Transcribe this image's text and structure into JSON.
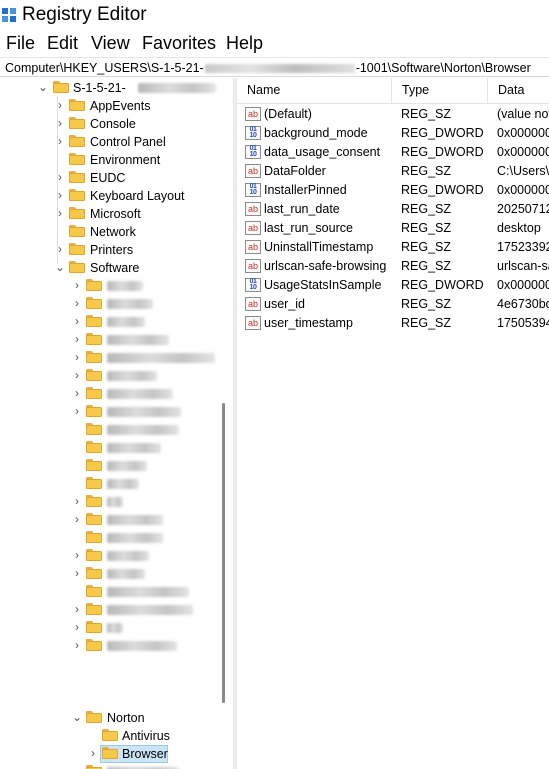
{
  "window": {
    "title": "Registry Editor",
    "icon": "registry-editor-icon"
  },
  "menu": [
    "File",
    "Edit",
    "View",
    "Favorites",
    "Help"
  ],
  "address": {
    "prefix": "Computer\\HKEY_USERS\\S-1-5-21-",
    "suffix": "-1001\\Software\\Norton\\Browser"
  },
  "tree": {
    "root": {
      "label": "S-1-5-21-",
      "expanded": true
    },
    "children": [
      {
        "label": "AppEvents",
        "expanded": false
      },
      {
        "label": "Console",
        "expanded": false
      },
      {
        "label": "Control Panel",
        "expanded": false
      },
      {
        "label": "Environment",
        "expanded": false
      },
      {
        "label": "EUDC",
        "expanded": false
      },
      {
        "label": "Keyboard Layout",
        "expanded": false
      },
      {
        "label": "Microsoft",
        "expanded": false
      },
      {
        "label": "Network",
        "expanded": false
      },
      {
        "label": "Printers",
        "expanded": false
      },
      {
        "label": "Software",
        "expanded": true
      }
    ],
    "software_children_redacted_count": 21,
    "norton": {
      "label": "Norton",
      "expanded": true
    },
    "norton_children": [
      {
        "label": "Antivirus",
        "selected": false
      },
      {
        "label": "Browser",
        "selected": true
      }
    ]
  },
  "values_table": {
    "columns": [
      "Name",
      "Type",
      "Data"
    ],
    "rows": [
      {
        "icon": "string-value-icon",
        "name": "(Default)",
        "type": "REG_SZ",
        "data": "(value not"
      },
      {
        "icon": "binary-value-icon",
        "name": "background_mode",
        "type": "REG_DWORD",
        "data": "0x0000000"
      },
      {
        "icon": "binary-value-icon",
        "name": "data_usage_consent",
        "type": "REG_DWORD",
        "data": "0x0000000"
      },
      {
        "icon": "string-value-icon",
        "name": "DataFolder",
        "type": "REG_SZ",
        "data": "C:\\Users\\"
      },
      {
        "icon": "binary-value-icon",
        "name": "InstallerPinned",
        "type": "REG_DWORD",
        "data": "0x0000000"
      },
      {
        "icon": "string-value-icon",
        "name": "last_run_date",
        "type": "REG_SZ",
        "data": "20250712T"
      },
      {
        "icon": "string-value-icon",
        "name": "last_run_source",
        "type": "REG_SZ",
        "data": "desktop"
      },
      {
        "icon": "string-value-icon",
        "name": "UninstallTimestamp",
        "type": "REG_SZ",
        "data": "17523392"
      },
      {
        "icon": "string-value-icon",
        "name": "urlscan-safe-browsing",
        "type": "REG_SZ",
        "data": "urlscan-sa"
      },
      {
        "icon": "binary-value-icon",
        "name": "UsageStatsInSample",
        "type": "REG_DWORD",
        "data": "0x0000000"
      },
      {
        "icon": "string-value-icon",
        "name": "user_id",
        "type": "REG_SZ",
        "data": "4e6730bd5"
      },
      {
        "icon": "string-value-icon",
        "name": "user_timestamp",
        "type": "REG_SZ",
        "data": "17505394"
      }
    ]
  },
  "colors": {
    "selection": "#cce4f7",
    "folder": "#f6c94b",
    "accent": "#1f6fd1"
  }
}
